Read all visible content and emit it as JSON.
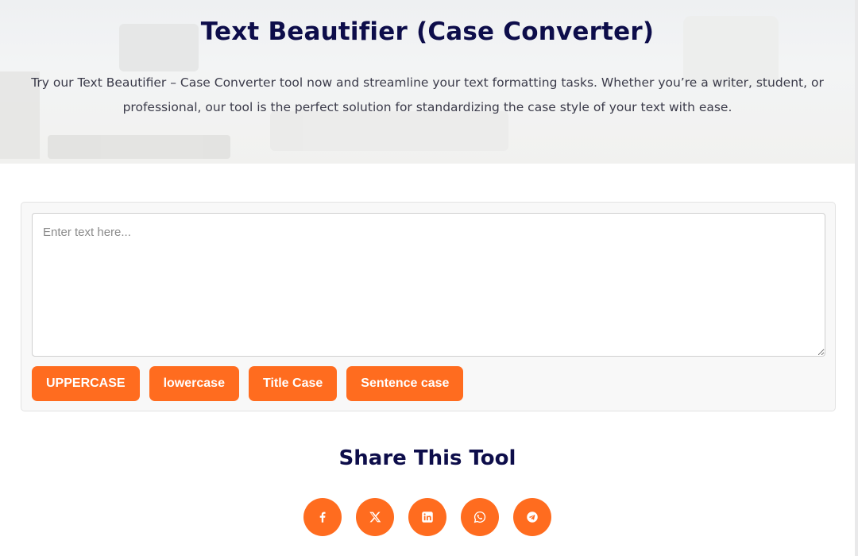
{
  "hero": {
    "title": "Text Beautifier (Case Converter)",
    "description": "Try our Text Beautifier – Case Converter tool now and streamline your text formatting tasks. Whether you’re a writer, student, or professional, our tool is the perfect solution for standardizing the case style of your text with ease."
  },
  "tool": {
    "input_placeholder": "Enter text here...",
    "input_value": "",
    "buttons": {
      "uppercase": "UPPERCASE",
      "lowercase": "lowercase",
      "title_case": "Title Case",
      "sentence_case": "Sentence case"
    }
  },
  "share": {
    "title": "Share This Tool",
    "icons": [
      "facebook-icon",
      "x-twitter-icon",
      "linkedin-icon",
      "whatsapp-icon",
      "telegram-icon"
    ]
  },
  "colors": {
    "accent": "#ff6c1f",
    "heading": "#0d0d4a",
    "body_text": "#3b3b4a"
  }
}
